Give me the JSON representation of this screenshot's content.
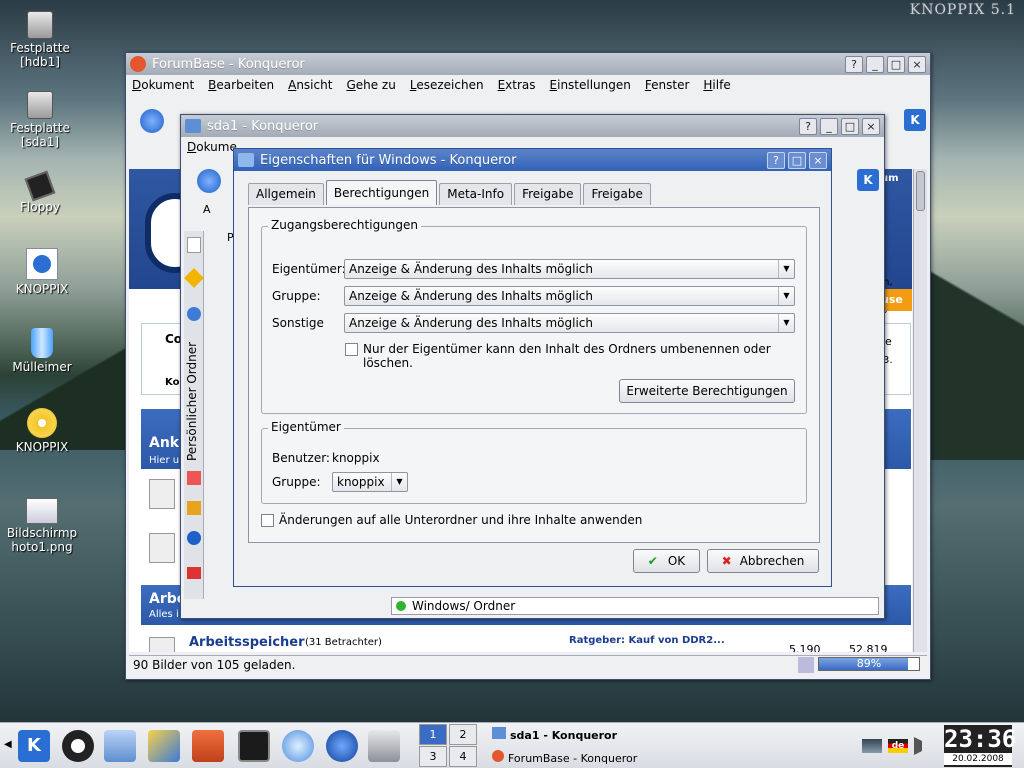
{
  "desktop": {
    "brand": "KNOPPIX 5.1",
    "icons": [
      {
        "label": "Festplatte\n[hdb1]",
        "icon": "harddisk-icon"
      },
      {
        "label": "Festplatte\n[sda1]",
        "icon": "harddisk-icon"
      },
      {
        "label": "Floppy",
        "icon": "floppy-icon"
      },
      {
        "label": "KNOPPIX",
        "icon": "knoppix-icon"
      },
      {
        "label": "Mülleimer",
        "icon": "trash-icon"
      },
      {
        "label": "KNOPPIX",
        "icon": "cdrom-icon"
      },
      {
        "label": "Bildschirmp\nhoto1.png",
        "icon": "image-file-icon"
      }
    ]
  },
  "forumbase": {
    "title": "ForumBase - Konqueror",
    "menu": [
      "Dokument",
      "Bearbeiten",
      "Ansicht",
      "Gehe zu",
      "Lesezeichen",
      "Extras",
      "Einstellungen",
      "Fenster",
      "Hilfe"
    ],
    "status": "90 Bilder von 105 geladen.",
    "progress_text": "89%",
    "progress": 0.89,
    "page_snippets": {
      "ank": "Ank",
      "hier": "Hier u",
      "arb": "Arbe",
      "alles": "Alles i",
      "ram": "Arbeitsspeicher",
      "ram_viewers": "(31 Betrachter)",
      "ratgeber": "Ratgeber: Kauf von DDR2...",
      "co": "Co",
      "kor": "Kor",
      "num1": "5.190",
      "num2": "52.819",
      "en": "en,",
      "gen": "ggen",
      "use": "use",
      "e": "e",
      "b": "3.",
      "um": "um"
    }
  },
  "sda1": {
    "title": "sda1 - Konqueror",
    "menu_first": "Dokume",
    "sidebar_label": "Persönlicher Ordner",
    "location_text": "Windows/  Ordner",
    "addr_a": "A",
    "addr_p": "P"
  },
  "dialog": {
    "title": "Eigenschaften für Windows - Konqueror",
    "tabs": [
      "Allgemein",
      "Berechtigungen",
      "Meta-Info",
      "Freigabe",
      "Freigabe"
    ],
    "access_group_title": "Zugangsberechtigungen",
    "owner_label": "Eigentümer:",
    "owner_value": "Anzeige & Änderung des Inhalts möglich",
    "group_label": "Gruppe:",
    "group_value": "Anzeige & Änderung des Inhalts möglich",
    "others_label": "Sonstige",
    "others_value": "Anzeige & Änderung des Inhalts möglich",
    "sticky_label": "Nur der Eigentümer kann den Inhalt des Ordners umbenennen oder löschen.",
    "advanced_button": "Erweiterte Berechtigungen",
    "ownership_group_title": "Eigentümer",
    "user_label": "Benutzer:",
    "user_value": "knoppix",
    "group2_label": "Gruppe:",
    "group2_value": "knoppix",
    "recursive_label": "Änderungen auf alle Unterordner und ihre Inhalte anwenden",
    "ok_button": "OK",
    "cancel_button": "Abbrechen"
  },
  "taskbar": {
    "pager": [
      "1",
      "2",
      "3",
      "4"
    ],
    "tasks": [
      "sda1 - Konqueror",
      "ForumBase - Konqueror"
    ],
    "lang": "de",
    "time": "23:36",
    "date": "20.02.2008"
  }
}
